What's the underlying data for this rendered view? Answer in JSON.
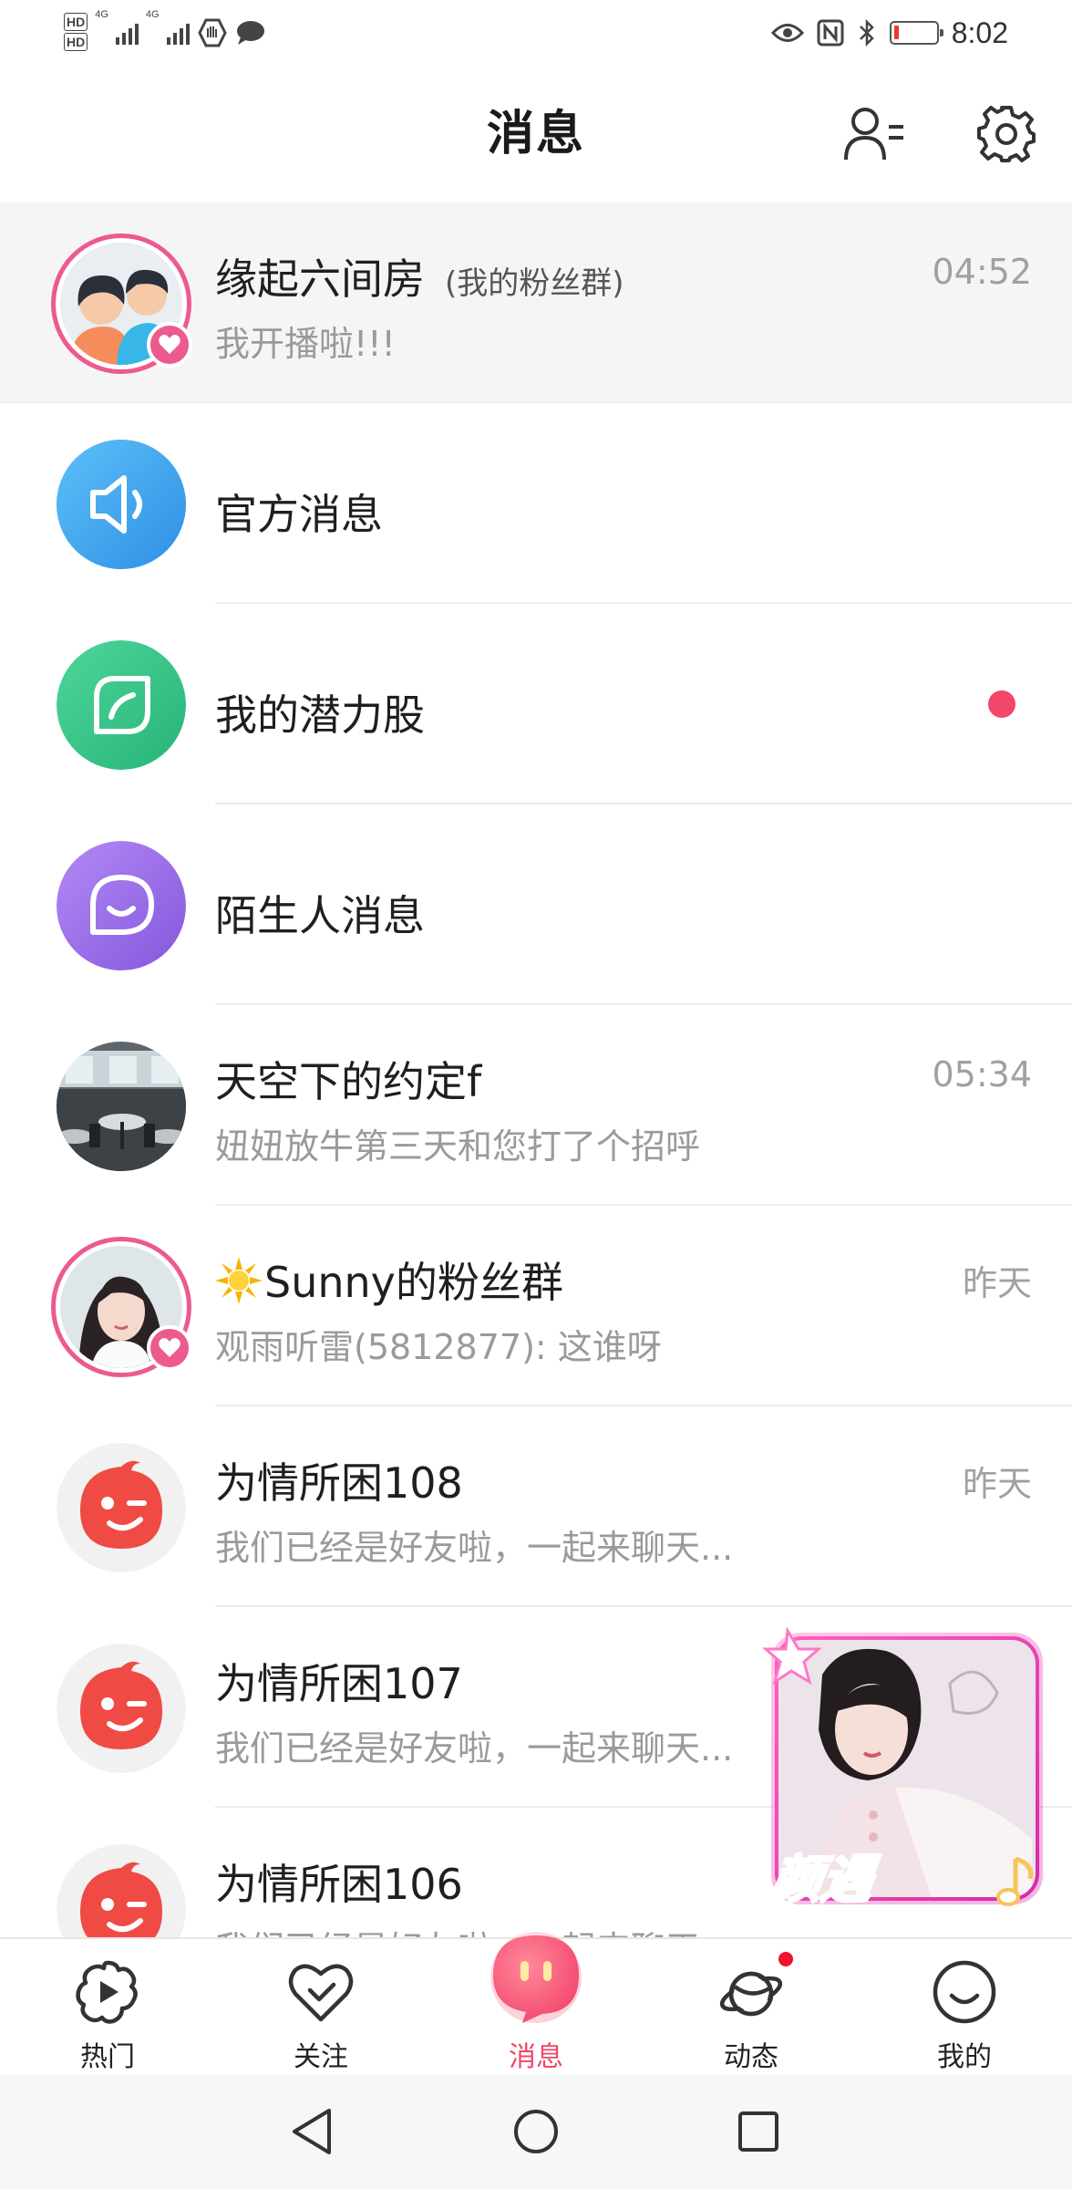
{
  "status_bar": {
    "sim1": "HD",
    "sim2": "HD",
    "net1": "4G",
    "net2": "4G",
    "time": "8:02"
  },
  "header": {
    "title": "消息",
    "contacts_icon": "contacts-list-icon",
    "settings_icon": "gear-icon"
  },
  "conversations": [
    {
      "title": "缘起六间房",
      "tag": "(我的粉丝群)",
      "subtitle": "我开播啦!!!",
      "time": "04:52",
      "pinned": true,
      "avatar": "couple-avatar"
    },
    {
      "title": "官方消息",
      "avatar": "speaker-icon",
      "color": "#3fa5ef"
    },
    {
      "title": "我的潜力股",
      "avatar": "leaf-icon",
      "color": "#34c48a",
      "unread": true
    },
    {
      "title": "陌生人消息",
      "avatar": "chat-bubble-icon",
      "color": "#9a6ee8"
    },
    {
      "title": "天空下的约定f",
      "subtitle": "妞妞放牛第三天和您打了个招呼",
      "time": "05:34",
      "avatar": "restaurant-photo"
    },
    {
      "title": "Sunny的粉丝群",
      "title_icon": "sun-icon",
      "subtitle": "观雨听雷(5812877): 这谁呀",
      "time": "昨天",
      "avatar": "woman-photo"
    },
    {
      "title": "为情所困108",
      "subtitle": "我们已经是好友啦，一起来聊天...",
      "time": "昨天",
      "avatar": "winking-face-avatar"
    },
    {
      "title": "为情所困107",
      "subtitle": "我们已经是好友啦，一起来聊天...",
      "avatar": "winking-face-avatar"
    },
    {
      "title": "为情所困106",
      "subtitle": "我们已经是好友啦，一起来聊天...",
      "avatar": "winking-face-avatar"
    }
  ],
  "promo": {
    "label": "颜遇"
  },
  "tabs": [
    {
      "label": "热门",
      "icon": "play-flower-icon"
    },
    {
      "label": "关注",
      "icon": "heart-check-icon"
    },
    {
      "label": "消息",
      "icon": "message-bubble-icon",
      "active": true
    },
    {
      "label": "动态",
      "icon": "planet-icon",
      "badge": true
    },
    {
      "label": "我的",
      "icon": "smile-icon"
    }
  ],
  "colors": {
    "accent": "#f2466b",
    "pink_ring": "#ec5a8f",
    "official_blue": "#3fa5ef",
    "green": "#34c48a",
    "purple": "#9a6ee8",
    "avatar_red": "#f04a45"
  }
}
